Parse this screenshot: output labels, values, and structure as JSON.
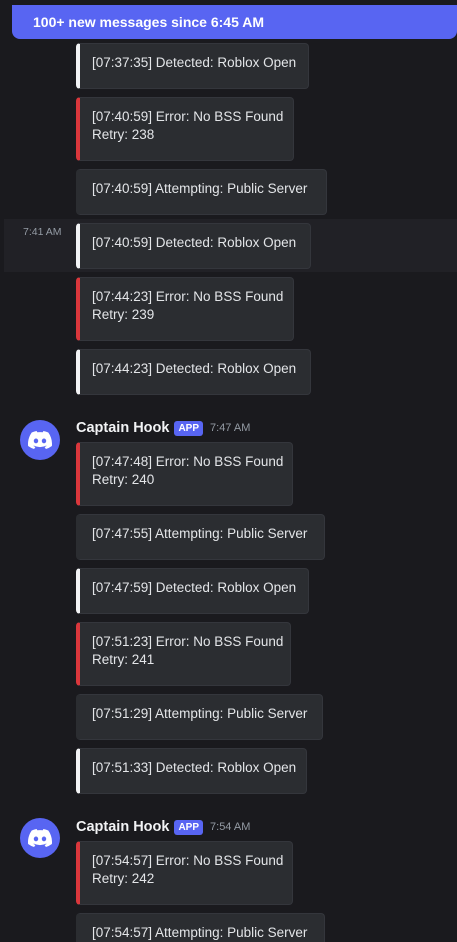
{
  "banner": {
    "text": "100+ new messages since 6:45 AM"
  },
  "gutter_time": "7:41 AM",
  "groups": [
    {
      "messages": [
        {
          "kind": "detected",
          "lines": [
            "[07:37:35] Detected: Roblox Open"
          ]
        },
        {
          "kind": "error",
          "lines": [
            "[07:40:59] Error: No BSS Found",
            "Retry: 238"
          ]
        },
        {
          "kind": "attempt",
          "lines": [
            "[07:40:59] Attempting: Public Server"
          ]
        },
        {
          "kind": "detected",
          "lines": [
            "[07:40:59] Detected: Roblox Open"
          ]
        },
        {
          "kind": "error",
          "lines": [
            "[07:44:23] Error: No BSS Found",
            "Retry: 239"
          ]
        },
        {
          "kind": "detected",
          "lines": [
            "[07:44:23] Detected: Roblox Open"
          ]
        }
      ]
    },
    {
      "author": "Captain Hook",
      "badge": "APP",
      "time": "7:47 AM",
      "messages": [
        {
          "kind": "error",
          "lines": [
            "[07:47:48] Error: No BSS Found",
            "Retry: 240"
          ]
        },
        {
          "kind": "attempt",
          "lines": [
            "[07:47:55] Attempting: Public Server"
          ]
        },
        {
          "kind": "detected",
          "lines": [
            "[07:47:59] Detected: Roblox Open"
          ]
        },
        {
          "kind": "error",
          "lines": [
            "[07:51:23] Error: No BSS Found",
            "Retry: 241"
          ]
        },
        {
          "kind": "attempt",
          "lines": [
            "[07:51:29] Attempting: Public Server"
          ]
        },
        {
          "kind": "detected",
          "lines": [
            "[07:51:33] Detected: Roblox Open"
          ]
        }
      ]
    },
    {
      "author": "Captain Hook",
      "badge": "APP",
      "time": "7:54 AM",
      "messages": [
        {
          "kind": "error",
          "lines": [
            "[07:54:57] Error: No BSS Found",
            "Retry: 242"
          ]
        },
        {
          "kind": "attempt",
          "lines": [
            "[07:54:57] Attempting: Public Server"
          ]
        }
      ]
    }
  ],
  "colors": {
    "accent": "#5865f2",
    "error": "#da373c",
    "detected": "#f2f3f5",
    "embed_bg": "#2b2d31"
  }
}
